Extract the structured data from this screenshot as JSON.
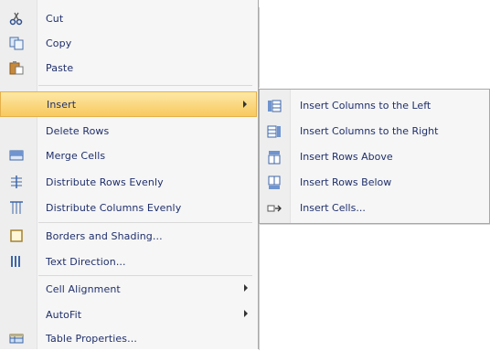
{
  "menu": {
    "items": [
      {
        "label": "Cut",
        "icon": "scissors-icon"
      },
      {
        "label": "Copy",
        "icon": "copy-icon"
      },
      {
        "label": "Paste",
        "icon": "paste-icon"
      },
      {
        "label": "Insert",
        "icon": "",
        "submenu": true,
        "highlighted": true
      },
      {
        "label": "Delete Rows",
        "icon": ""
      },
      {
        "label": "Merge Cells",
        "icon": "merge-cells-icon"
      },
      {
        "label": "Distribute Rows Evenly",
        "icon": "distribute-rows-icon"
      },
      {
        "label": "Distribute Columns Evenly",
        "icon": "distribute-columns-icon"
      },
      {
        "label": "Borders and Shading...",
        "icon": "borders-icon"
      },
      {
        "label": "Text Direction...",
        "icon": "text-direction-icon"
      },
      {
        "label": "Cell Alignment",
        "icon": "",
        "submenu": true
      },
      {
        "label": "AutoFit",
        "icon": "",
        "submenu": true
      },
      {
        "label": "Table Properties...",
        "icon": "table-properties-icon"
      }
    ]
  },
  "submenu": {
    "items": [
      {
        "label": "Insert Columns to the Left",
        "icon": "insert-columns-left-icon"
      },
      {
        "label": "Insert Columns to the Right",
        "icon": "insert-columns-right-icon"
      },
      {
        "label": "Insert Rows Above",
        "icon": "insert-rows-above-icon"
      },
      {
        "label": "Insert Rows Below",
        "icon": "insert-rows-below-icon"
      },
      {
        "label": "Insert Cells...",
        "icon": "insert-cells-icon"
      }
    ]
  },
  "colors": {
    "highlight": "#f8c95e",
    "menu_bg": "#f6f6f6",
    "text": "#1f2f6b"
  }
}
